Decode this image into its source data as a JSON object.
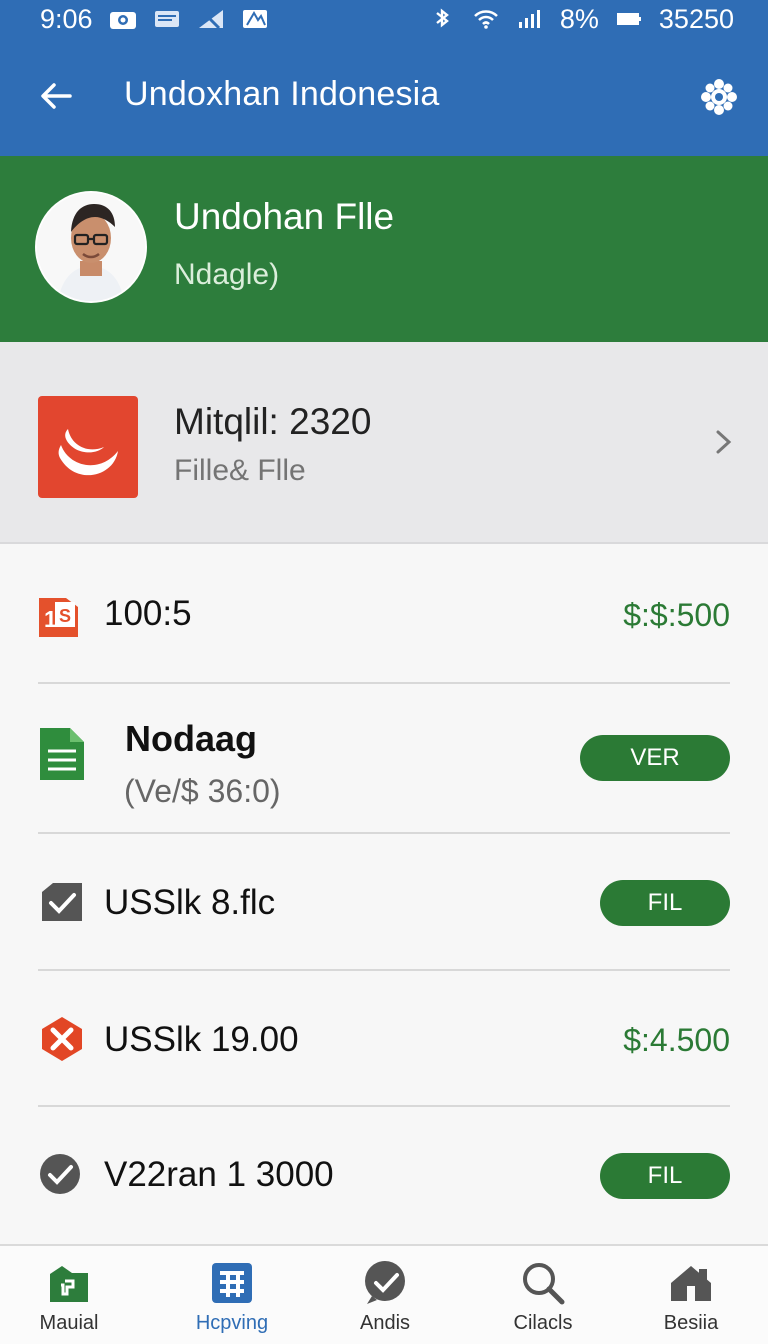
{
  "status_bar": {
    "time": "9:06",
    "battery": "8%",
    "extra": "35250"
  },
  "app_bar": {
    "title": "Undoxhan Indonesia"
  },
  "profile": {
    "name": "Undohan Flle",
    "subtitle": "Ndagle)"
  },
  "featured": {
    "title": "Mitqlil: 2320",
    "subtitle": "Fille& Flle"
  },
  "list": [
    {
      "title": "100:5",
      "value": "$:$:500"
    },
    {
      "title": "Nodaag",
      "subtitle": "(Ve/$ 36:0)",
      "action": "VER"
    },
    {
      "title": "USSlk 8.flc",
      "action": "FIL"
    },
    {
      "title": "USSlk 19.00",
      "value": "$:4.500"
    },
    {
      "title": "V22ran 1 3000",
      "action": "FIL"
    }
  ],
  "bottom_nav": [
    {
      "label": "Mauial",
      "icon": "folder-icon"
    },
    {
      "label": "Hcpving",
      "icon": "grid-icon",
      "active": true
    },
    {
      "label": "Andis",
      "icon": "check-circle-icon"
    },
    {
      "label": "Cilacls",
      "icon": "search-icon"
    },
    {
      "label": "Besiia",
      "icon": "home-icon"
    }
  ],
  "colors": {
    "primary": "#2f6db5",
    "green": "#2d7d3c",
    "accent_green": "#2b7a35",
    "red": "#e2462f"
  }
}
